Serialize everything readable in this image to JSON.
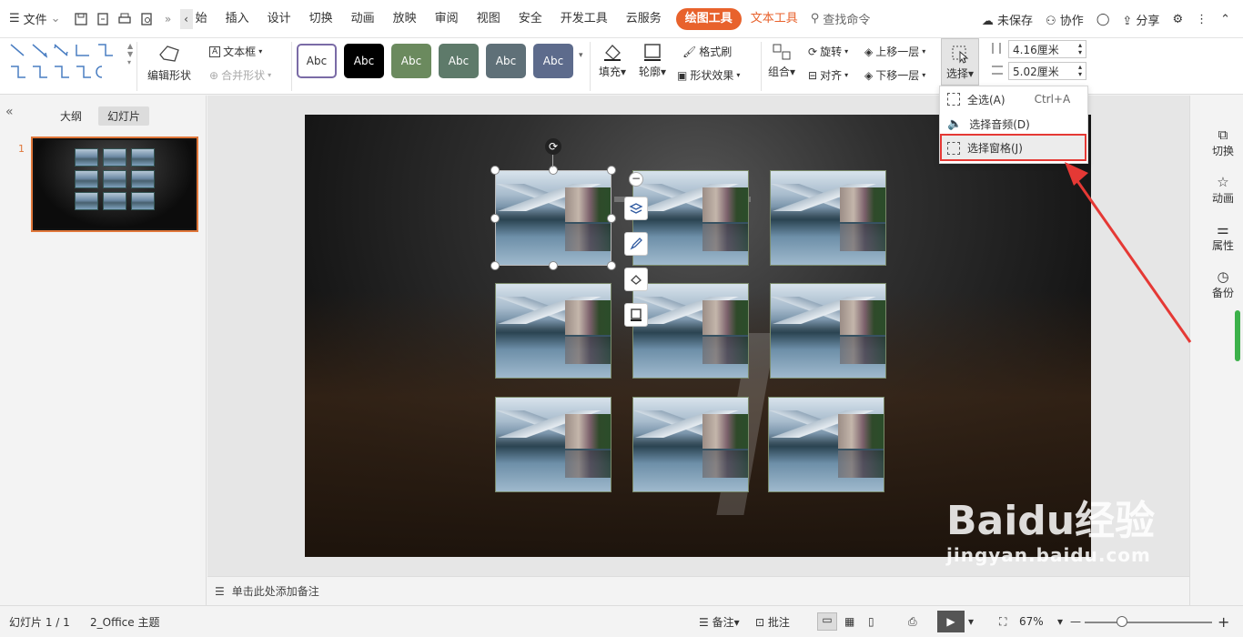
{
  "topbar": {
    "file_menu": "文件",
    "tabs": [
      "始",
      "插入",
      "设计",
      "切换",
      "动画",
      "放映",
      "审阅",
      "视图",
      "安全",
      "开发工具",
      "云服务"
    ],
    "tab_drawing_tools": "绘图工具",
    "tab_text_tools": "文本工具",
    "search": "查找命令",
    "unsaved": "未保存",
    "collaborate": "协作",
    "share": "分享"
  },
  "ribbon": {
    "edit_shape": "编辑形状",
    "text_box": "文本框",
    "merge_shape": "合并形状",
    "style_label": "Abc",
    "style_colors": [
      "#ffffff",
      "#000000",
      "#6b8a5e",
      "#5e7a6a",
      "#5f7078",
      "#5d6b8c"
    ],
    "fill": "填充",
    "outline": "轮廓",
    "format_painter": "格式刷",
    "shape_effect": "形状效果",
    "group": "组合",
    "rotate": "旋转",
    "align": "对齐",
    "bring_forward": "上移一层",
    "send_backward": "下移一层",
    "select": "选择",
    "height_value": "4.16厘米",
    "width_value": "5.02厘米"
  },
  "dropdown": {
    "select_all": "全选(A)",
    "select_all_shortcut": "Ctrl+A",
    "select_audio": "选择音频(D)",
    "selection_pane": "选择窗格(J)"
  },
  "leftpanel": {
    "outline_tab": "大纲",
    "slides_tab": "幻灯片",
    "slide_number": "1"
  },
  "notes": {
    "placeholder": "单击此处添加备注"
  },
  "rightpanel": {
    "transition": "切换",
    "animation": "动画",
    "properties": "属性",
    "backup": "备份"
  },
  "statusbar": {
    "slide_info": "幻灯片 1 / 1",
    "theme": "2_Office 主题",
    "notes_btn": "备注",
    "comments_btn": "批注",
    "zoom": "67%"
  },
  "watermark": {
    "brand": "Baidu经验",
    "url": "jingyan.baidu.com"
  },
  "colors": {
    "accent": "#e8622c",
    "highlight": "#e53935"
  }
}
